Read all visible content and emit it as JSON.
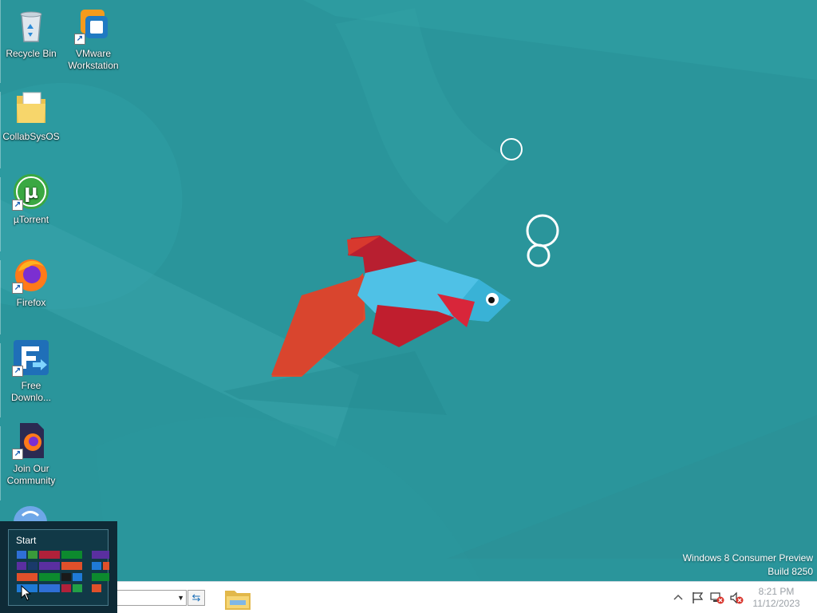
{
  "desktop": {
    "icons": [
      {
        "label_line1": "Recycle Bin",
        "label_line2": "",
        "icon": "recycle-bin-icon",
        "shortcut": false
      },
      {
        "label_line1": "VMware",
        "label_line2": "Workstation",
        "icon": "vmware-icon",
        "shortcut": true
      },
      {
        "label_line1": "CollabSysOS",
        "label_line2": "",
        "icon": "folder-icon",
        "shortcut": false
      },
      {
        "label_line1": "µTorrent",
        "label_line2": "",
        "icon": "utorrent-icon",
        "shortcut": true
      },
      {
        "label_line1": "Firefox",
        "label_line2": "",
        "icon": "firefox-icon",
        "shortcut": true
      },
      {
        "label_line1": "Free",
        "label_line2": "Downlo...",
        "icon": "free-download-manager-icon",
        "shortcut": true
      },
      {
        "label_line1": "Join Our",
        "label_line2": "Community",
        "icon": "firefox-document-icon",
        "shortcut": true
      }
    ]
  },
  "watermark": {
    "line1": "Windows 8 Consumer Preview",
    "line2": "Build 8250"
  },
  "taskbar": {
    "address_value": "",
    "go_icon": "go-arrow-icon",
    "pinned": [
      {
        "name": "file-explorer",
        "icon": "folder-icon"
      }
    ],
    "tray": {
      "icons": [
        "show-hidden-icons-chevron-icon",
        "action-center-flag-icon",
        "network-error-icon",
        "speaker-muted-icon"
      ],
      "time": "8:21 PM",
      "date": "11/12/2023"
    }
  },
  "start_thumbnail": {
    "label": "Start",
    "tile_colors": [
      "#2f6fd6",
      "#3a9a3a",
      "#b0213a",
      "#0c8a2e",
      "#5a2fa0",
      "#e0502a",
      "#1f7ad6",
      "#1a1a1a",
      "#22a046"
    ]
  },
  "colors": {
    "wallpaper": "#2a959b",
    "fish_body": "#4fc1e6",
    "fish_red": "#c01e2e",
    "fish_orange": "#e04b2d"
  }
}
